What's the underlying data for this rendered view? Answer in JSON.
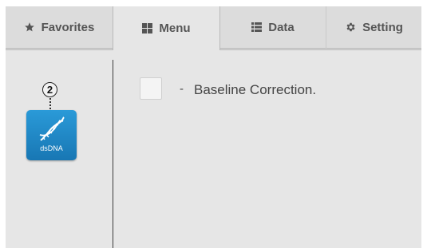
{
  "tabs": {
    "favorites": {
      "label": "Favorites",
      "icon": "star-icon"
    },
    "menu": {
      "label": "Menu",
      "icon": "grid-icon",
      "active": true
    },
    "data": {
      "label": "Data",
      "icon": "list-icon"
    },
    "setting": {
      "label": "Setting",
      "icon": "gear-icon"
    }
  },
  "sidebar": {
    "step_number": "2",
    "app_tile": {
      "label": "dsDNA",
      "icon": "dna-icon",
      "color": "#1e88c9"
    }
  },
  "main": {
    "option": {
      "dash": "-",
      "label": "Baseline Correction.",
      "checked": false
    }
  }
}
